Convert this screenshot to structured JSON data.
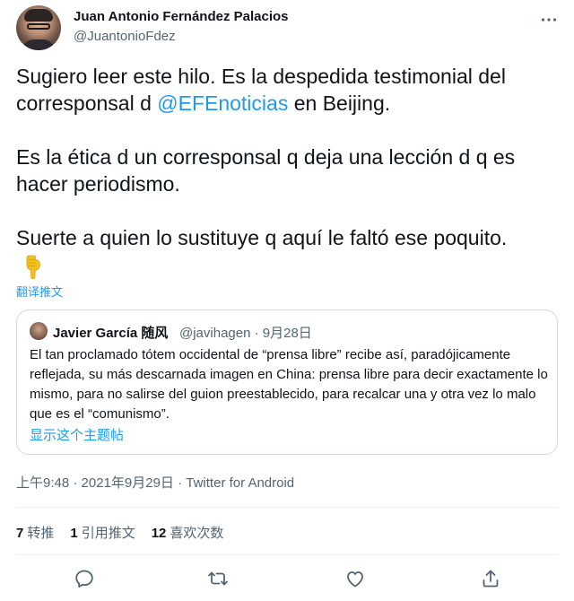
{
  "author": {
    "name": "Juan Antonio Fernández Palacios",
    "handle": "@JuantonioFdez"
  },
  "tweet": {
    "line1_before": "Sugiero leer este hilo. Es la despedida testimonial del corresponsal d ",
    "mention": "@EFEnoticias",
    "line1_after": " en Beijing.",
    "paragraph2": "Es la ética d un corresponsal q deja una lección d q es hacer periodismo.",
    "paragraph3": "Suerte a quien lo sustituye q aquí le faltó ese poquito.",
    "translate_label": "翻译推文"
  },
  "quote": {
    "name": "Javier García 随风",
    "handle_date": "@javihagen · 9月28日",
    "text": "El tan proclamado tótem occidental de “prensa libre” recibe así, paradójicamente reflejada, su más descarnada imagen en China: prensa libre para decir exactamente lo mismo, para no salirse del guion preestablecido, para recalcar una y otra vez lo malo que es el “comunismo”.",
    "show_thread": "显示这个主题帖"
  },
  "meta": {
    "time_date": "上午9:48 · 2021年9月29日 · ",
    "source": "Twitter for Android"
  },
  "stats": {
    "retweets_count": "7",
    "retweets_label": "转推",
    "quotes_count": "1",
    "quotes_label": "引用推文",
    "likes_count": "12",
    "likes_label": "喜欢次数"
  },
  "icons": {
    "more": "more-icon",
    "reply": "reply-icon",
    "retweet": "retweet-icon",
    "like": "heart-icon",
    "share": "share-icon",
    "emoji": "pointing-down-emoji"
  },
  "colors": {
    "accent": "#1d9bf0",
    "text": "#0f1419",
    "secondary": "#536471",
    "border": "#cfd9de"
  }
}
